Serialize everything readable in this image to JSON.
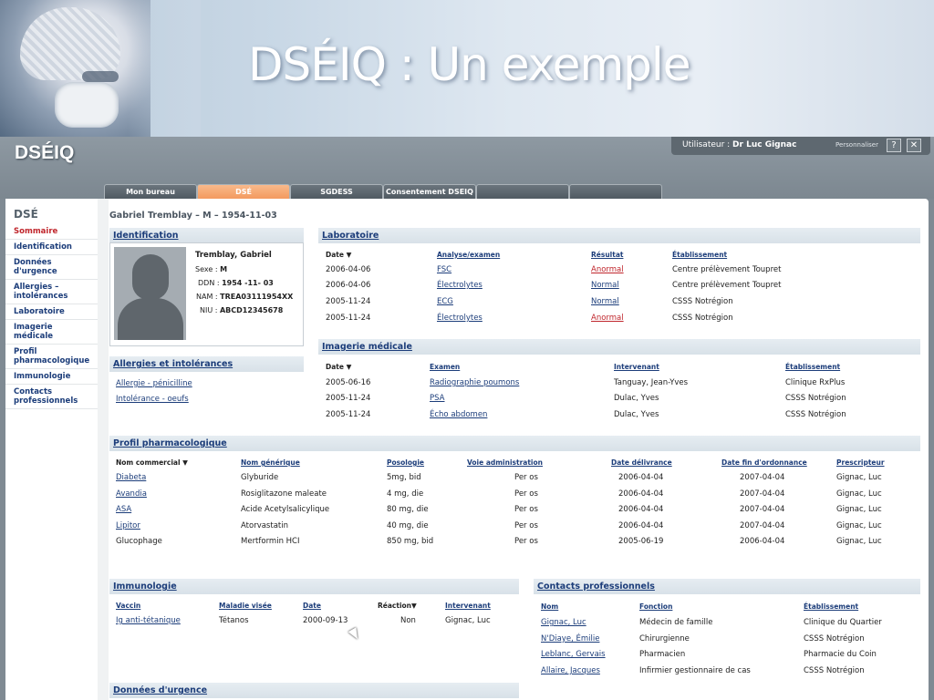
{
  "banner": {
    "title": "DSÉIQ : Un exemple"
  },
  "header": {
    "logo": "DSÉIQ",
    "user_label": "Utilisateur : ",
    "user_name": "Dr Luc Gignac",
    "personalize": "Personnaliser",
    "help": "?",
    "close": "✕"
  },
  "tabs": [
    "Mon bureau",
    "DSÉ",
    "SGDESS",
    "Consentement DSEIQ",
    "",
    ""
  ],
  "sidebar": {
    "title": "DSÉ",
    "items": [
      "Sommaire",
      "Identification",
      "Données d'urgence",
      "Allergies – intolérances",
      "Laboratoire",
      "Imagerie médicale",
      "Profil pharmacologique",
      "Immunologie",
      "Contacts professionnels"
    ]
  },
  "patient_header": "Gabriel Tremblay – M – 1954-11-03",
  "identification": {
    "title": "Identification",
    "name": "Tremblay, Gabriel",
    "sexe_label": "Sexe :",
    "sexe": "M",
    "ddn_label": "DDN :",
    "ddn": "1954 -11- 03",
    "nam_label": "NAM :",
    "nam": "TREA03111954XX",
    "niu_label": "NIU :",
    "niu": "ABCD12345678"
  },
  "allergies": {
    "title": "Allergies et intolérances",
    "items": [
      "Allergie - pénicilline",
      "Intolérance - oeufs"
    ]
  },
  "laboratoire": {
    "title": "Laboratoire",
    "headers": [
      "Date ▼",
      "Analyse/examen",
      "Résultat",
      "Établissement"
    ],
    "rows": [
      [
        "2006-04-06",
        "FSC",
        "Anormal",
        "Centre prélèvement Toupret"
      ],
      [
        "2006-04-06",
        "Électrolytes",
        "Normal",
        "Centre prélèvement Toupret"
      ],
      [
        "2005-11-24",
        "ECG",
        "Normal",
        "CSSS Notrégion"
      ],
      [
        "2005-11-24",
        "Électrolytes",
        "Anormal",
        "CSSS Notrégion"
      ]
    ]
  },
  "imagerie": {
    "title": "Imagerie médicale",
    "headers": [
      "Date ▼",
      "Examen",
      "Intervenant",
      "Établissement"
    ],
    "rows": [
      [
        "2005-06-16",
        "Radiographie poumons",
        "Tanguay, Jean-Yves",
        "Clinique RxPlus"
      ],
      [
        "2005-11-24",
        "PSA",
        "Dulac, Yves",
        "CSSS Notrégion"
      ],
      [
        "2005-11-24",
        "Écho abdomen",
        "Dulac, Yves",
        "CSSS Notrégion"
      ]
    ]
  },
  "profil": {
    "title": "Profil pharmacologique",
    "headers": [
      "Nom commercial ▼",
      "Nom générique",
      "Posologie",
      "Voie administration",
      "Date délivrance",
      "Date fin d'ordonnance",
      "Prescripteur"
    ],
    "rows": [
      [
        "Diabeta",
        "Glyburide",
        "5mg, bid",
        "Per os",
        "2006-04-04",
        "2007-04-04",
        "Gignac, Luc"
      ],
      [
        "Avandia",
        "Rosiglitazone maleate",
        "4 mg, die",
        "Per os",
        "2006-04-04",
        "2007-04-04",
        "Gignac, Luc"
      ],
      [
        "ASA",
        "Acide Acetylsalicylique",
        "80 mg, die",
        "Per os",
        "2006-04-04",
        "2007-04-04",
        "Gignac, Luc"
      ],
      [
        "Lipitor",
        "Atorvastatin",
        "40 mg, die",
        "Per os",
        "2006-04-04",
        "2007-04-04",
        "Gignac, Luc"
      ],
      [
        "Glucophage",
        "Mertformin HCI",
        "850 mg, bid",
        "Per os",
        "2005-06-19",
        "2006-04-04",
        "Gignac, Luc"
      ]
    ]
  },
  "immunologie": {
    "title": "Immunologie",
    "headers": [
      "Vaccin",
      "Maladie visée",
      "Date",
      "Réaction▼",
      "Intervenant"
    ],
    "rows": [
      [
        "Ig anti-tétanique",
        "Tétanos",
        "2000-09-13",
        "Non",
        "Gignac, Luc"
      ]
    ]
  },
  "contacts": {
    "title": "Contacts professionnels",
    "headers": [
      "Nom",
      "Fonction",
      "Établissement"
    ],
    "rows": [
      [
        "Gignac, Luc",
        "Médecin de famille",
        "Clinique du Quartier"
      ],
      [
        "N'Diaye, Émilie",
        "Chirurgienne",
        "CSSS Notrégion"
      ],
      [
        "Leblanc, Gervais",
        "Pharmacien",
        "Pharmacie du Coin"
      ],
      [
        "Allaire, Jacques",
        "Infirmier gestionnaire de cas",
        "CSSS Notrégion"
      ]
    ]
  },
  "urgence": {
    "title": "Données d'urgence"
  }
}
